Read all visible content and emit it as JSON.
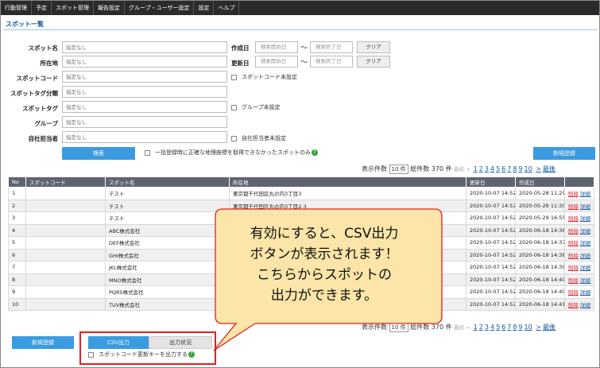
{
  "nav": [
    "行動管理",
    "予定",
    "スポット管理",
    "報告設定",
    "グループ・ユーザー設定",
    "設定",
    "ヘルプ"
  ],
  "page_title": "スポット一覧",
  "filters": {
    "spot_name": {
      "label": "スポット名",
      "placeholder": "指定なし"
    },
    "address": {
      "label": "所在地",
      "placeholder": "指定なし"
    },
    "spot_code": {
      "label": "スポットコード",
      "placeholder": "指定なし"
    },
    "spot_tag_cat": {
      "label": "スポットタグ分類",
      "placeholder": "指定なし"
    },
    "spot_tag": {
      "label": "スポットタグ",
      "placeholder": "指定なし"
    },
    "group": {
      "label": "グループ",
      "placeholder": "指定なし"
    },
    "owner": {
      "label": "自社担当者",
      "placeholder": "指定なし"
    },
    "created": {
      "label": "作成日",
      "start": "検索開始日",
      "end": "検索終了日"
    },
    "updated": {
      "label": "更新日",
      "start": "検索開始日",
      "end": "検索終了日"
    },
    "tilde": "～",
    "clear": "クリア",
    "code_unset": "スポットコード未設定",
    "group_unset": "グループ未設定",
    "owner_unset": "自社担当者未設定"
  },
  "search_button": "検索",
  "geo_check": "一括登録時に正確な地理座標を取得できなかったスポットのみ",
  "help_icon": "?",
  "new_button": "新規登録",
  "pager": {
    "label": "表示件数",
    "per": "10 件",
    "total": "総件数 370 件",
    "first": "最初",
    "prev": "<",
    "pages": [
      "1",
      "2",
      "3",
      "4",
      "5",
      "6",
      "7",
      "8",
      "9",
      "10"
    ],
    "next": ">",
    "last": "最後"
  },
  "table": {
    "headers": [
      "No",
      "スポットコード",
      "スポット名",
      "所在地",
      "更新日",
      "作成日"
    ],
    "rows": [
      [
        "1",
        "",
        "テスト",
        "東京都千代田区丸の内3丁目3",
        "2020-10-07 14:52",
        "2020-05-28 11:29"
      ],
      [
        "2",
        "",
        "テスト",
        "東京都千代田区丸の内3丁目2-3",
        "2020-10-07 14:52",
        "2020-05-28 11:30"
      ],
      [
        "3",
        "",
        "テスト",
        "",
        "2020-10-07 14:52",
        "2020-05-29 16:55"
      ],
      [
        "4",
        "",
        "ABC株式会社",
        "",
        "2020-10-07 14:52",
        "2020-06-18 14:36"
      ],
      [
        "5",
        "",
        "DEF株式会社",
        "",
        "2020-10-07 14:52",
        "2020-06-18 14:37"
      ],
      [
        "6",
        "",
        "GHI株式会社",
        "",
        "2020-10-07 14:52",
        "2020-06-18 14:38"
      ],
      [
        "7",
        "",
        "JKL株式会社",
        "",
        "2020-10-07 14:52",
        "2020-06-18 14:39"
      ],
      [
        "8",
        "",
        "MNO株式会社",
        "",
        "2020-10-07 14:52",
        "2020-06-18 14:40"
      ],
      [
        "9",
        "",
        "PQRS株式会社",
        "",
        "2020-10-07 14:52",
        "2020-06-18 14:40"
      ],
      [
        "10",
        "",
        "TUV株式会社",
        "",
        "2020-10-07 14:52",
        "2020-06-18 14:41"
      ]
    ],
    "delete": "削除",
    "detail": "詳細"
  },
  "csv_button": "CSV出力",
  "output_status": "出力状況",
  "csv_code_check": "スポットコード更新キーを出力する",
  "callout": [
    "有効にすると、CSV出力",
    "ボタンが表示されます！",
    "こちらからスポットの",
    "出力ができます。"
  ],
  "colors": {
    "accent": "#3b9be0",
    "nav": "#2b2b2b",
    "callout_fill": "#fbe5a8",
    "callout_border": "#e02020"
  }
}
